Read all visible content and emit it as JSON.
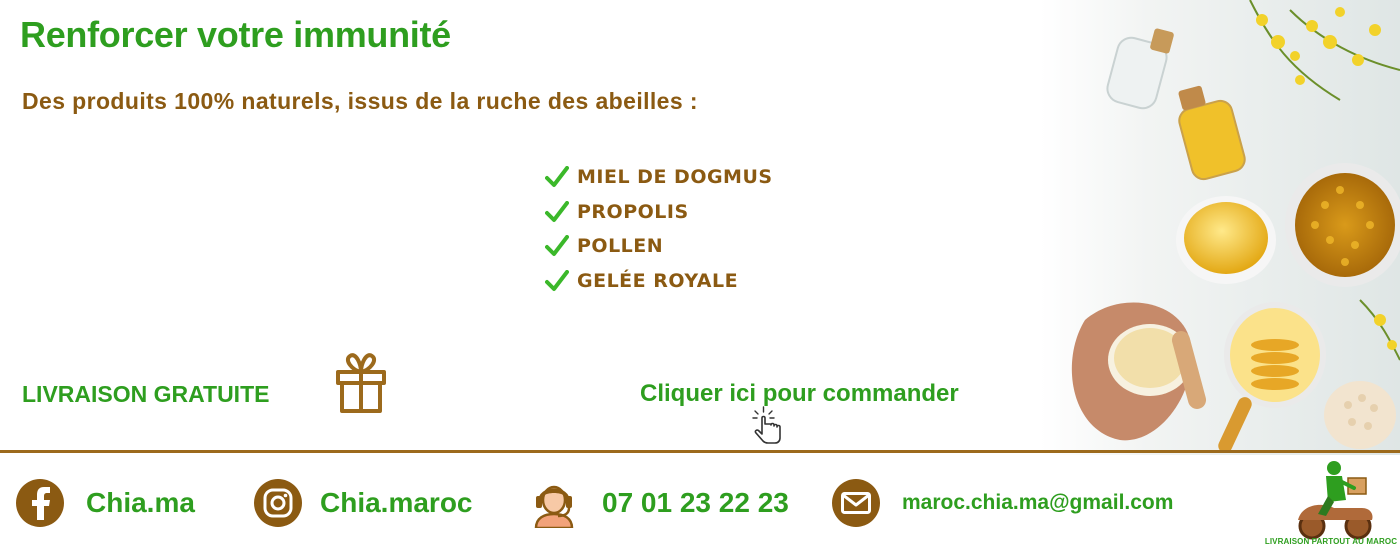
{
  "header": {
    "title": "Renforcer votre immunité",
    "subtitle": "Des produits 100% naturels, issus de la ruche des abeilles :"
  },
  "products": [
    "MIEL DE DOGMUS",
    "PROPOLIS",
    "POLLEN",
    "GELÉE ROYALE"
  ],
  "promo": {
    "free_delivery": "LIVRAISON GRATUITE",
    "cta": "Cliquer ici pour commander"
  },
  "footer": {
    "facebook": "Chia.ma",
    "instagram": "Chia.maroc",
    "phone": "07 01 23 22 23",
    "email": "maroc.chia.ma@gmail.com",
    "delivery_caption": "LIVRAISON PARTOUT AU MAROC"
  },
  "icons": {
    "facebook": "facebook-icon",
    "instagram": "instagram-icon",
    "phone": "headset-support-icon",
    "email": "envelope-icon",
    "gift": "gift-icon",
    "cursor": "pointer-hand-icon",
    "check": "checkmark-icon",
    "delivery": "delivery-scooter-icon"
  },
  "colors": {
    "green": "#2e9e1f",
    "brown": "#8b5a12",
    "divider": "#9c6a1c"
  }
}
